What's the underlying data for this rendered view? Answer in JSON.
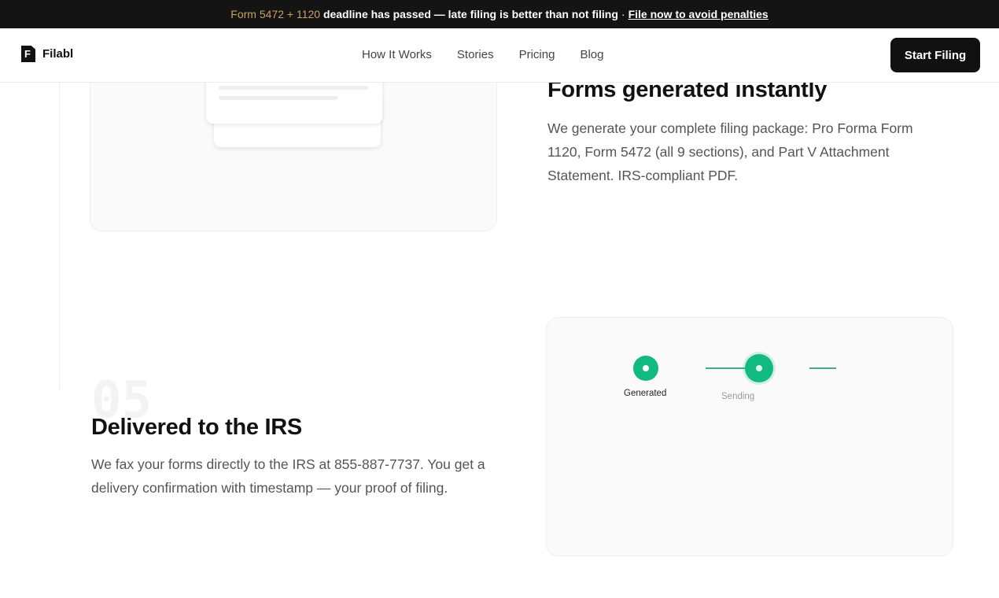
{
  "announcement": {
    "forms": "Form 5472 + 1120",
    "message": "deadline has passed — late filing is better than not filing",
    "separator": "·",
    "link": "File now to avoid penalties"
  },
  "header": {
    "brand": "Filabl",
    "nav": [
      "How It Works",
      "Stories",
      "Pricing",
      "Blog"
    ],
    "cta": "Start Filing"
  },
  "step4": {
    "title": "Forms generated instantly",
    "description": "We generate your complete filing package: Pro Forma Form 1120, Form 5472 (all 9 sections), and Part V Attachment Statement. IRS-compliant PDF."
  },
  "step5": {
    "number": "05",
    "title": "Delivered to the IRS",
    "description": "We fax your forms directly to the IRS at 855-887-7737. You get a delivery confirmation with timestamp — your proof of filing.",
    "progress": {
      "steps": [
        "Generated",
        "Sending"
      ]
    }
  },
  "colors": {
    "accent_gold": "#c9a063",
    "status_green": "#12b981",
    "dark": "#111111"
  }
}
